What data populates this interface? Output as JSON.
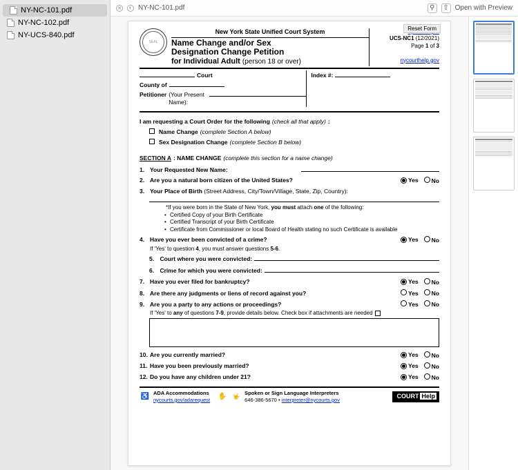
{
  "sidebar": {
    "items": [
      {
        "label": "NY-NC-101.pdf",
        "selected": true
      },
      {
        "label": "NY-NC-102.pdf",
        "selected": false
      },
      {
        "label": "NY-UCS-840.pdf",
        "selected": false
      }
    ]
  },
  "topbar": {
    "filename": "NY-NC-101.pdf",
    "open_with": "Open with Preview"
  },
  "reset_btn": "Reset Form",
  "header": {
    "system": "New York State Unified Court System",
    "title_l1": "Name Change and/or Sex",
    "title_l2": "Designation Change Petition",
    "title_l3_a": "for Individual Adult",
    "title_l3_b": "(person 18 or over)",
    "link_top": "nycourts.gov",
    "form_id": "UCS-NC1",
    "form_date": "(12/2021)",
    "page_of": "Page 1 of 3",
    "link_bot": "nycourthelp.gov"
  },
  "caption": {
    "court": "Court",
    "county": "County of",
    "petitioner": "Petitioner",
    "petitioner_note": "(Your Present Name):",
    "index": "Index #:"
  },
  "intro": {
    "text": "I am requesting a Court Order for the following",
    "hint": "(check all that apply)",
    "opt1": "Name Change",
    "opt1_hint": "(complete Section A below)",
    "opt2": "Sex Designation Change",
    "opt2_hint": "(complete Section B below)"
  },
  "sectA": {
    "title": "SECTION A",
    "label": ": NAME CHANGE",
    "hint": "(complete this section for a name change)"
  },
  "q1": {
    "num": "1.",
    "text": "Your Requested New Name:"
  },
  "q2": {
    "num": "2.",
    "text": "Are you a natural born citizen of the United States?"
  },
  "q3": {
    "num": "3.",
    "text_a": "Your Place of Birth",
    "text_b": "(Street Address, City/Town/Village, State, Zip, Country):"
  },
  "birth_note": {
    "lead": "*If you were born in the State of New York,",
    "must": "you must",
    "attach": "attach",
    "one": "one",
    "tail": "of the following:",
    "b1": "Certified Copy of your Birth Certificate",
    "b2": "Certified Transcript of your Birth Certificate",
    "b3": "Certificate from Commissioner or local Board of Health stating no such Certificate is available"
  },
  "q4": {
    "num": "4.",
    "text": "Have you ever been convicted of a crime?",
    "sub_a": "If 'Yes' to question",
    "sub_b": "4",
    "sub_c": ", you must answer questions",
    "sub_d": "5-6"
  },
  "q5": {
    "num": "5.",
    "text": "Court where you were convicted:"
  },
  "q6": {
    "num": "6.",
    "text": "Crime for which you were convicted:"
  },
  "q7": {
    "num": "7.",
    "text": "Have you ever filed for bankruptcy?"
  },
  "q8": {
    "num": "8.",
    "text": "Are there any judgments or liens of record against you?"
  },
  "q9": {
    "num": "9.",
    "text": "Are you a party to any actions or proceedings?",
    "sub_a": "If 'Yes' to",
    "sub_b": "any",
    "sub_c": "of questions",
    "sub_d": "7-9",
    "sub_e": ", provide details below.   Check box if attachments are needed"
  },
  "q10": {
    "num": "10.",
    "text": "Are you currently married?"
  },
  "q11": {
    "num": "11.",
    "text": "Have you been previously married?"
  },
  "q12": {
    "num": "12.",
    "text": "Do you have any children under 21?"
  },
  "yes": "Yes",
  "no": "No",
  "footer": {
    "ada_label": "ADA Accommodations",
    "ada_link": "nycourts.gov/adarequest",
    "interp_label": "Spoken or Sign Language Interpreters",
    "interp_phone": "646-386-5670",
    "interp_link": "interpreter@nycourts.gov",
    "court_a": "COURT",
    "court_b": "Help"
  }
}
